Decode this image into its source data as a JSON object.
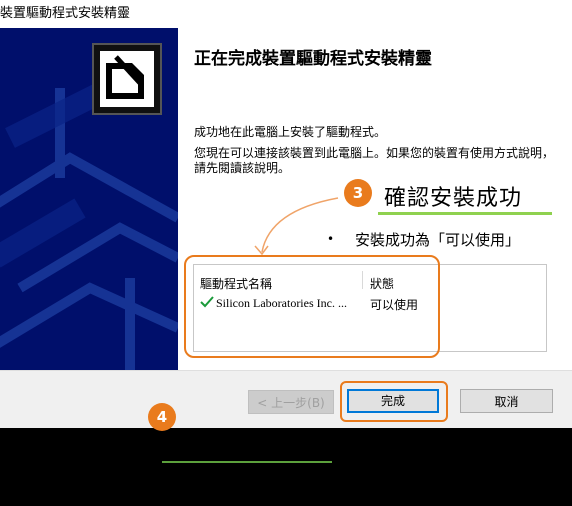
{
  "window": {
    "title": "裝置驅動程式安裝精靈"
  },
  "content": {
    "heading": "正在完成裝置驅動程式安裝精靈",
    "line1": "成功地在此電腦上安裝了驅動程式。",
    "paragraph": "您現在可以連接該裝置到此電腦上。如果您的裝置有使用方式說明，請先閱讀該說明。"
  },
  "annotations": {
    "step3_number": "3",
    "step3_title": "確認安裝成功",
    "bullet": "•",
    "step3_bullet": "安裝成功為「可以使用」",
    "step4_number": "4"
  },
  "driver_table": {
    "headers": [
      "驅動程式名稱",
      "狀態"
    ],
    "rows": [
      {
        "name": "Silicon Laboratories Inc. ...",
        "status": "可以使用",
        "icon": "checkmark-icon"
      }
    ]
  },
  "buttons": {
    "back": "< 上一步(B)",
    "finish": "完成",
    "cancel": "取消"
  },
  "colors": {
    "accent": "#e97b1d",
    "side_panel": "#000f6b",
    "underline": "#8fd14f",
    "check": "#1a9a3a"
  }
}
